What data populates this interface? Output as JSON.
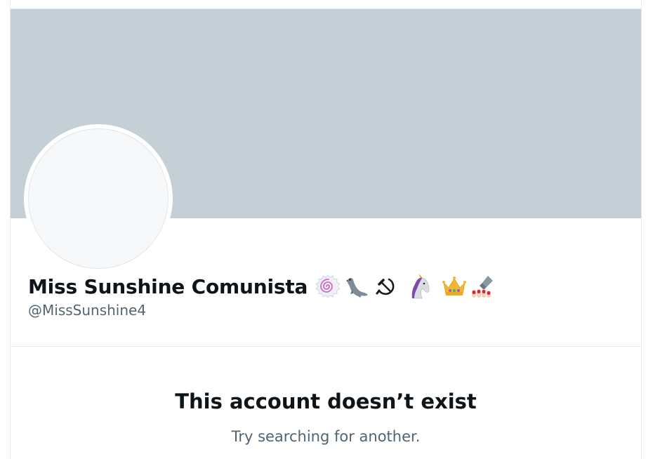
{
  "profile": {
    "display_name": "Miss Sunshine Comunista",
    "name_emojis": [
      "fish-cake-swirl",
      "seal",
      "hammer-and-sickle",
      "unicorn",
      "crown",
      "nail-polish"
    ],
    "handle": "@MissSunshine4"
  },
  "empty_state": {
    "title": "This account doesn’t exist",
    "subtitle": "Try searching for another."
  },
  "colors": {
    "banner": "#c4cfd6",
    "avatar_fill": "#f7f8f9",
    "text_primary": "#0f1419",
    "text_secondary": "#536471",
    "border": "#e6ecf0"
  }
}
